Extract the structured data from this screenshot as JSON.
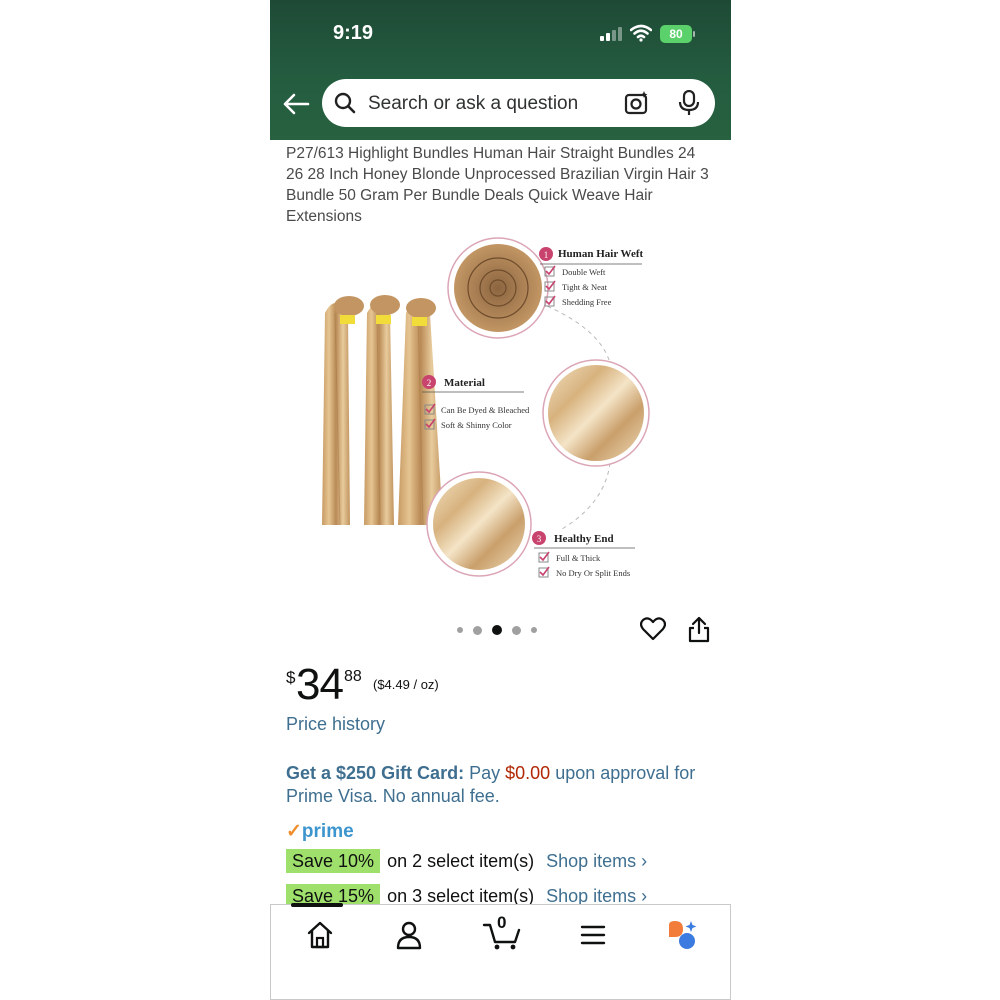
{
  "status": {
    "time": "9:19",
    "battery": "80"
  },
  "search": {
    "placeholder": "Search or ask a question"
  },
  "product": {
    "title": "P27/613 Highlight Bundles Human Hair Straight Bundles 24 26 28 Inch Honey Blonde Unprocessed Brazilian Virgin Hair 3 Bundle 50 Gram Per Bundle Deals Quick Weave Hair Extensions",
    "image": {
      "section1": {
        "num": "1",
        "title": "Human Hair Weft",
        "items": [
          "Double Weft",
          "Tight & Neat",
          "Shedding Free"
        ]
      },
      "section2": {
        "num": "2",
        "title": "Material",
        "items": [
          "Can Be Dyed & Bleached",
          "Soft & Shinny Color"
        ]
      },
      "section3": {
        "num": "3",
        "title": "Healthy End",
        "items": [
          "Full & Thick",
          "No Dry Or Split Ends"
        ]
      }
    },
    "carousel": {
      "count": 5,
      "active": 3
    }
  },
  "price": {
    "currency": "$",
    "whole": "34",
    "fraction": "88",
    "unit_price": "($4.49 / oz)",
    "history_label": "Price history"
  },
  "gift_card": {
    "headline": "Get a $250 Gift Card:",
    "pre": "Pay",
    "amount": "$0.00",
    "post": "upon approval for Prime Visa. No annual fee."
  },
  "prime": {
    "label": "prime"
  },
  "promos": [
    {
      "badge": "Save 10%",
      "text": "on 2 select item(s)",
      "link": "Shop items ›"
    },
    {
      "badge": "Save 15%",
      "text": "on 3 select item(s)",
      "link": "Shop items ›"
    }
  ],
  "cart": {
    "count": "0"
  },
  "colors": {
    "header": "#245c40",
    "link": "#3f6f90",
    "price_red": "#b12704",
    "promo_badge": "#9ee06b",
    "check": "#c8436d"
  }
}
